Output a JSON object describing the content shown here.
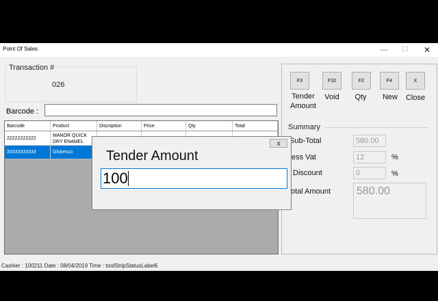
{
  "window": {
    "title": "Point Of Sales",
    "controls": {
      "minimize": "—",
      "maximize": "☐",
      "close": "✕"
    }
  },
  "transaction": {
    "label": "Transaction #",
    "number": "026"
  },
  "barcode": {
    "label": "Barcode :",
    "value": ""
  },
  "grid": {
    "columns": [
      "Barcode",
      "Product",
      "Discription",
      "Price",
      "Qty",
      "Total"
    ],
    "rows": [
      {
        "barcode": "22222222222",
        "product": "MANOR QUICK DRY ENAMEL",
        "description": "",
        "price": "",
        "qty": "",
        "total": "",
        "selected": false
      },
      {
        "barcode": "33333333333",
        "product": "Globesco",
        "description": "",
        "price": "",
        "qty": "",
        "total": "",
        "selected": true
      }
    ]
  },
  "function_buttons": [
    {
      "key": "F3",
      "label": "Tender Amount"
    },
    {
      "key": "F10",
      "label": "Void"
    },
    {
      "key": "F2",
      "label": "Qty"
    },
    {
      "key": "F4",
      "label": "New"
    },
    {
      "key": "X",
      "label": "Close"
    }
  ],
  "summary": {
    "title": "Summary",
    "subtotal": {
      "label": "Sub-Total",
      "value": "580.00"
    },
    "less_vat": {
      "label": "ess Vat",
      "value": "12",
      "unit": "%"
    },
    "discount": {
      "label": "Discount",
      "value": "0",
      "unit": "%"
    },
    "total_amount": {
      "label": "otal Amount",
      "value": "580.00"
    }
  },
  "status_bar": {
    "text": "Cashier :  100211  Date :  08/04/2019  Time :  toolStripStatusLabel6"
  },
  "dialog": {
    "title": "Tender Amount",
    "close": "X",
    "value": "100"
  }
}
